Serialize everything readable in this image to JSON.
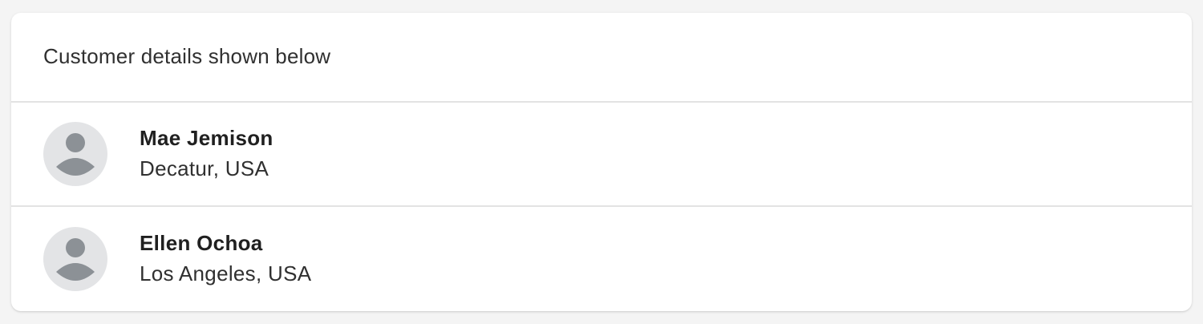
{
  "header": {
    "title": "Customer details shown below"
  },
  "customers": [
    {
      "name": "Mae Jemison",
      "location": "Decatur, USA",
      "avatar_icon": "person-icon"
    },
    {
      "name": "Ellen Ochoa",
      "location": "Los Angeles, USA",
      "avatar_icon": "person-icon"
    }
  ],
  "colors": {
    "background": "#f4f4f4",
    "card": "#ffffff",
    "divider": "#e3e3e3",
    "avatar_bg": "#e3e4e6",
    "avatar_figure": "#8c9196"
  }
}
